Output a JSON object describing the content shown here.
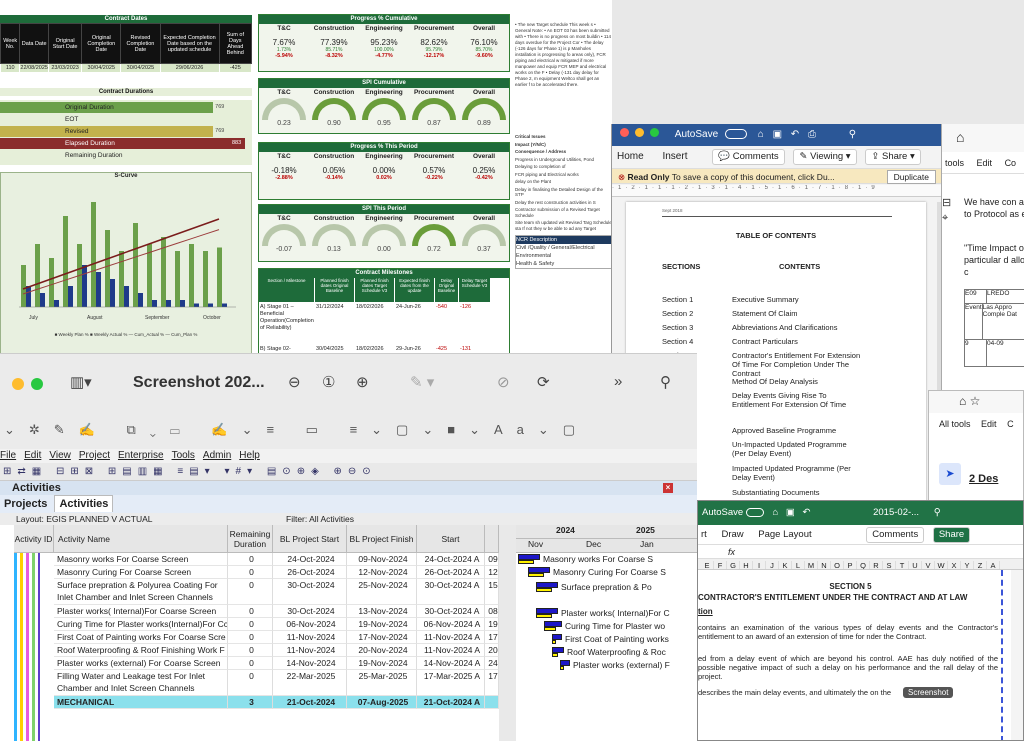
{
  "dashboard": {
    "contract_dates": {
      "title": "Contract Dates",
      "headers": [
        "Week No.",
        "Data Date",
        "Original Start Date",
        "Original Completion Date",
        "Revised Completion Date",
        "Expected Completion Date based on the updated schedule",
        "Sum of Days Ahead Behind"
      ],
      "row": [
        "110",
        "22/08/2025",
        "23/03/2023",
        "30/04/2025",
        "30/04/2025",
        "29/06/2026",
        "-425"
      ]
    },
    "contract_durations": {
      "title": "Contract Durations",
      "bars": [
        {
          "label": "Original Duration",
          "value": "769",
          "fill": 0.87,
          "color": "#6ba04a"
        },
        {
          "label": "EOT",
          "value": "",
          "fill": 0,
          "color": "#c8d96b"
        },
        {
          "label": "Revised",
          "value": "769",
          "fill": 0.87,
          "color": "#c2b24c"
        },
        {
          "label": "Elapsed Duration",
          "value": "883",
          "fill": 1.0,
          "color": "#8b2c2c"
        },
        {
          "label": "Remaining Duration",
          "value": "",
          "fill": 0,
          "color": "#d8e7c8"
        }
      ]
    },
    "scurve": {
      "title": "S-Curve",
      "xlabels": [
        "July",
        "August",
        "September",
        "October"
      ],
      "legend": "■ Weekly Plan % ■ Weekly Actual % — Cum_Actual % — Cum_Plan %"
    },
    "progress_cumulative": {
      "title": "Progress % Cumulative",
      "cells": [
        {
          "name": "T&C",
          "a": "7.67%",
          "b": "1.73%",
          "var": "-5.94%"
        },
        {
          "name": "Construction",
          "a": "77.39%",
          "b": "85.71%",
          "var": "-8.32%"
        },
        {
          "name": "Engineering",
          "a": "95.23%",
          "b": "100.00%",
          "var": "-4.77%"
        },
        {
          "name": "Procurement",
          "a": "82.62%",
          "b": "95.79%",
          "var": "-12.17%"
        },
        {
          "name": "Overall",
          "a": "76.10%",
          "b": "85.70%",
          "var": "-9.60%"
        }
      ]
    },
    "spi_cumulative": {
      "title": "SPI Cumulative",
      "cells": [
        {
          "name": "T&C",
          "value": "0.23",
          "fill": 0.23
        },
        {
          "name": "Construction",
          "value": "0.90",
          "fill": 0.9
        },
        {
          "name": "Engineering",
          "value": "0.95",
          "fill": 0.95
        },
        {
          "name": "Procurement",
          "value": "0.87",
          "fill": 0.87
        },
        {
          "name": "Overall",
          "value": "0.89",
          "fill": 0.89
        }
      ]
    },
    "progress_period": {
      "title": "Progress % This Period",
      "cells": [
        {
          "name": "T&C",
          "a": "-0.18%",
          "var": "-2.88%"
        },
        {
          "name": "Construction",
          "a": "0.05%",
          "var": "-0.14%"
        },
        {
          "name": "Engineering",
          "a": "0.00%",
          "var": "0.02%"
        },
        {
          "name": "Procurement",
          "a": "0.57%",
          "var": "-0.22%"
        },
        {
          "name": "Overall",
          "a": "0.25%",
          "var": "-0.42%"
        }
      ]
    },
    "spi_period": {
      "title": "SPI This Period",
      "cells": [
        {
          "name": "T&C",
          "value": "-0.07",
          "fill": 0
        },
        {
          "name": "Construction",
          "value": "0.13",
          "fill": 0.13
        },
        {
          "name": "Engineering",
          "value": "0.00",
          "fill": 0
        },
        {
          "name": "Procurement",
          "value": "0.72",
          "fill": 0.72
        },
        {
          "name": "Overall",
          "value": "0.37",
          "fill": 0.37
        }
      ]
    },
    "milestones": {
      "title": "Contract Milestones",
      "headers": [
        "Section / Milestone",
        "Planned finish dates Original Baseline",
        "Planned finish dates Target Schedule V3",
        "Expected finish dates from the update",
        "Delay Original Baseline",
        "Delay Target Schedule V3"
      ],
      "rows": [
        [
          "A) Stage 01 – Beneficial Operation(Completion of Reliability)",
          "31/12/2024",
          "18/02/2026",
          "24-Jun-26",
          "-540",
          "-126"
        ],
        [
          "B) Stage 02- Engineers",
          "30/04/2025",
          "18/02/2026",
          "29-Jun-26",
          "-425",
          "-131"
        ]
      ]
    },
    "notes": "• The new Target schedule This week s • General Note: • An EOT 03 has been submitted with • There is no progress on most buildin • 114 days overdue for the Project Cor • The delay (-126 days for Phase 1) is p Manholes installation is progressing fo areas only), FCR piping and electrical w mitigated if more manpower and equip FCR MEP and electrical works on the F • Delay (-131 day delay for Phase 2, m equipment Weltco shall get an earlier f to be accelerated there."
  },
  "word": {
    "autosave": "AutoSave",
    "menu": [
      "Home",
      "Insert"
    ],
    "comments": "Comments",
    "viewing": "Viewing",
    "share": "Share",
    "readonly_label": "Read Only",
    "readonly_msg": "To save a copy of this document, click Du...",
    "duplicate": "Duplicate",
    "header_date": "Sept 2018",
    "toc_title": "TABLE OF CONTENTS",
    "col_sections": "SECTIONS",
    "col_contents": "CONTENTS",
    "toc": [
      {
        "s": "Section 1",
        "c": "Executive Summary"
      },
      {
        "s": "Section 2",
        "c": "Statement Of Claim"
      },
      {
        "s": "Section 3",
        "c": "Abbreviations And Clarifications"
      },
      {
        "s": "Section 4",
        "c": "Contract Particulars"
      },
      {
        "s": "Section 5",
        "c": "Contractor's Entitlement For Extension Of Time For Completion Under The Contract"
      },
      {
        "s": "",
        "c": "Method Of Delay Analysis"
      },
      {
        "s": "",
        "c": "Delay Events Giving Rise To Entitlement For Extension Of Time"
      },
      {
        "s": "A",
        "c": "Approved Baseline Programme"
      },
      {
        "s": "B",
        "c": "Un-Impacted Updated Programme (Per Delay Event)"
      },
      {
        "s": "C",
        "c": "Impacted Updated Programme (Per Delay Event)"
      },
      {
        "s": "D",
        "c": "Substantiating Documents"
      }
    ],
    "critical_issues": [
      "Critical Issues",
      "Impact (Y/N/C)",
      "Consequence / Address",
      "Progress in Underground Utilities, Pond",
      "Delaying to completion of",
      "FCR piping and Electrical works",
      "delay on the Plant",
      "Delay in finalising the Detailed Design of the STP",
      "Delay the rest construction activities in S",
      "Contractor submission of a Revised Target Schedule",
      "Site team sh updated wit Revised Targ Schedule sta If not they w be able to ad any Target"
    ],
    "ncr": [
      "NCR Description",
      "Civil /Quality / General/Electrical",
      "Environmental",
      "Health & Safety"
    ]
  },
  "rwin1": {
    "menu": [
      "tools",
      "Edit",
      "Co"
    ],
    "text1": "We have con according to Protocol as e",
    "bold": "\"Time Impact of particular d allowing the c",
    "table": [
      "E09",
      "LREDO",
      "Event",
      "Las Appro Comple Dat",
      "9",
      "04-09"
    ]
  },
  "rwin2": {
    "menu": [
      "All tools",
      "Edit",
      "C"
    ],
    "heading": "2 Des"
  },
  "excel": {
    "autosave": "AutoSave",
    "filename": "2015-02-...",
    "menu": [
      "rt",
      "Draw",
      "Page Layout"
    ],
    "comments": "Comments",
    "share": "Share",
    "fx": "fx",
    "columns": [
      "E",
      "F",
      "G",
      "H",
      "I",
      "J",
      "K",
      "L",
      "M",
      "N",
      "O",
      "P",
      "Q",
      "R",
      "S",
      "T",
      "U",
      "V",
      "W",
      "X",
      "Y",
      "Z",
      "A"
    ],
    "section": "SECTION 5",
    "heading": "CONTRACTOR'S ENTITLEMENT UNDER THE CONTRACT AND AT LAW",
    "sub": "tion",
    "p1": "contains an examination of the various types of delay events and the Contractor's entitlement to an award of an extension of time for nder the Contract.",
    "p2": "ed from a delay event of which are beyond his control. AAE has duly notified of the possible negative impact of such a delay on his performance and the rall delay of the project.",
    "p3": "describes the main delay events, and ultimately the on the",
    "tooltip": "Screenshot"
  },
  "preview": {
    "title": "Screenshot 202...",
    "p6_menu": [
      "File",
      "Edit",
      "View",
      "Project",
      "Enterprise",
      "Tools",
      "Admin",
      "Help"
    ],
    "panel_title": "Activities",
    "tabs": [
      "Projects",
      "Activities"
    ],
    "layout": "Layout: EGIS PLANNED V ACTUAL",
    "filter": "Filter: All Activities",
    "columns": [
      "Activity ID",
      "Activity Name",
      "Remaining Duration",
      "BL Project Start",
      "BL Project Finish",
      "Start",
      ""
    ],
    "gantt_years": [
      "2024",
      "2025"
    ],
    "gantt_months": [
      "Nov",
      "Dec",
      "Jan"
    ],
    "rows": [
      {
        "name": "Masonry works For Coarse Screen",
        "rd": "0",
        "bs": "24-Oct-2024",
        "bf": "09-Nov-2024",
        "st": "24-Oct-2024 A",
        "x": "09"
      },
      {
        "name": "Masonry Curing For Coarse Screen",
        "rd": "0",
        "bs": "26-Oct-2024",
        "bf": "12-Nov-2024",
        "st": "26-Oct-2024 A",
        "x": "12"
      },
      {
        "name": "Surface prepration & Polyurea Coating For Inlet Chamber and Inlet Screen Channels",
        "rd": "0",
        "bs": "30-Oct-2024",
        "bf": "25-Nov-2024",
        "st": "30-Oct-2024 A",
        "x": "15"
      },
      {
        "name": "Plaster works( Internal)For Coarse Screen",
        "rd": "0",
        "bs": "30-Oct-2024",
        "bf": "13-Nov-2024",
        "st": "30-Oct-2024 A",
        "x": "08"
      },
      {
        "name": "Curing Time for Plaster works(Internal)For Cc",
        "rd": "0",
        "bs": "06-Nov-2024",
        "bf": "19-Nov-2024",
        "st": "06-Nov-2024 A",
        "x": "19"
      },
      {
        "name": "First Coat of Painting works For Coarse Scre",
        "rd": "0",
        "bs": "11-Nov-2024",
        "bf": "17-Nov-2024",
        "st": "11-Nov-2024 A",
        "x": "17"
      },
      {
        "name": "Roof Waterproofing & Roof Finishing Work F",
        "rd": "0",
        "bs": "11-Nov-2024",
        "bf": "20-Nov-2024",
        "st": "11-Nov-2024 A",
        "x": "20"
      },
      {
        "name": "Plaster works (external) For Coarse Screen",
        "rd": "0",
        "bs": "14-Nov-2024",
        "bf": "19-Nov-2024",
        "st": "14-Nov-2024 A",
        "x": "24"
      },
      {
        "name": "Filling Water  and Leakage test For Inlet Chamber and Inlet Screen Channels",
        "rd": "0",
        "bs": "22-Mar-2025",
        "bf": "25-Mar-2025",
        "st": "17-Mar-2025 A",
        "x": "17"
      },
      {
        "name": "MECHANICAL",
        "rd": "3",
        "bs": "21-Oct-2024",
        "bf": "07-Aug-2025",
        "st": "21-Oct-2024 A",
        "x": ""
      }
    ],
    "gantt_labels": [
      "Masonry works For Coarse S",
      "Masonry Curing For Coarse S",
      "Surface prepration & Po",
      "Plaster works( Internal)For C",
      "Curing Time for Plaster wo",
      "First Coat of Painting works",
      "Roof Waterproofing & Roc",
      "Plaster works (external) F"
    ]
  }
}
